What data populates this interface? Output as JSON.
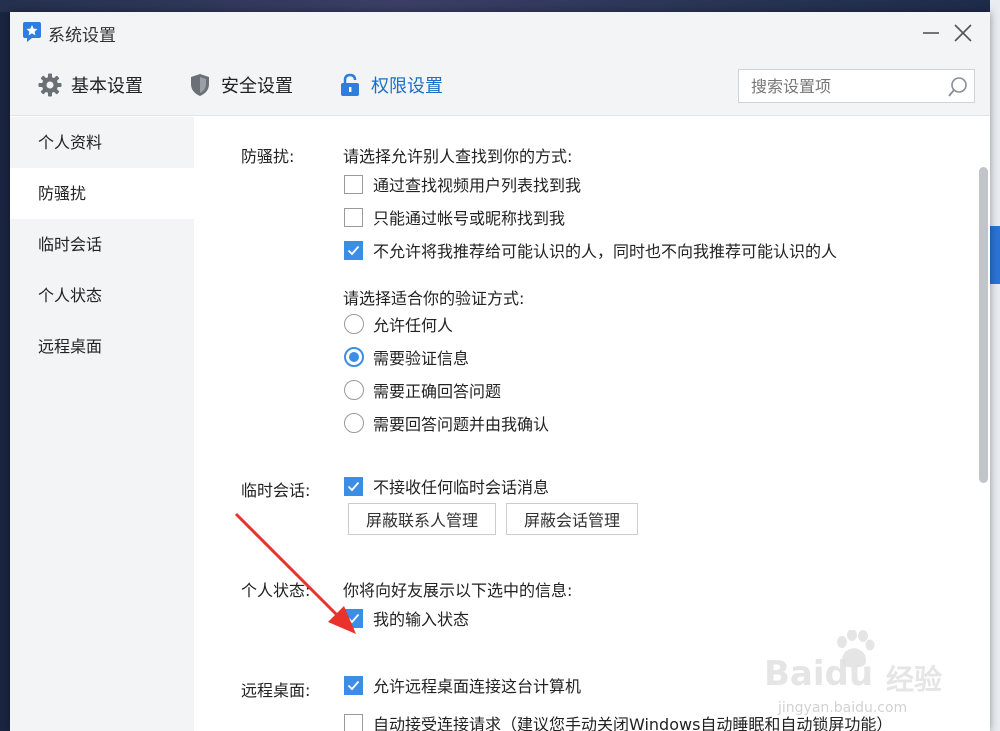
{
  "window": {
    "title": "系统设置"
  },
  "tabs": [
    {
      "label": "基本设置",
      "icon": "gear-icon"
    },
    {
      "label": "安全设置",
      "icon": "shield-icon"
    },
    {
      "label": "权限设置",
      "icon": "lock-icon",
      "active": true
    }
  ],
  "search": {
    "placeholder": "搜索设置项"
  },
  "sidebar": {
    "items": [
      {
        "label": "个人资料"
      },
      {
        "label": "防骚扰",
        "active": true
      },
      {
        "label": "临时会话"
      },
      {
        "label": "个人状态"
      },
      {
        "label": "远程桌面"
      }
    ]
  },
  "anti_harass": {
    "label": "防骚扰:",
    "find_prompt": "请选择允许别人查找到你的方式:",
    "find_options": [
      {
        "label": "通过查找视频用户列表找到我",
        "checked": false
      },
      {
        "label": "只能通过帐号或昵称找到我",
        "checked": false
      },
      {
        "label": "不允许将我推荐给可能认识的人，同时也不向我推荐可能认识的人",
        "checked": true
      }
    ],
    "verify_prompt": "请选择适合你的验证方式:",
    "verify_options": [
      {
        "label": "允许任何人",
        "selected": false
      },
      {
        "label": "需要验证信息",
        "selected": true
      },
      {
        "label": "需要正确回答问题",
        "selected": false
      },
      {
        "label": "需要回答问题并由我确认",
        "selected": false
      }
    ]
  },
  "temp_chat": {
    "label": "临时会话:",
    "option": {
      "label": "不接收任何临时会话消息",
      "checked": true
    },
    "buttons": [
      "屏蔽联系人管理",
      "屏蔽会话管理"
    ]
  },
  "status": {
    "label": "个人状态:",
    "prompt": "你将向好友展示以下选中的信息:",
    "option": {
      "label": "我的输入状态",
      "checked": true
    }
  },
  "remote": {
    "label": "远程桌面:",
    "options": [
      {
        "label": "允许远程桌面连接这台计算机",
        "checked": true
      },
      {
        "label": "自动接受连接请求（建议您手动关闭Windows自动睡眠和自动锁屏功能）",
        "checked": false
      }
    ]
  },
  "watermark": {
    "brand": "Baidu",
    "cn": "经验",
    "url": "jingyan.baidu.com"
  },
  "colors": {
    "accent": "#3b8de6",
    "active_tab": "#1a6fc4",
    "annotation_arrow": "#e8322b"
  }
}
